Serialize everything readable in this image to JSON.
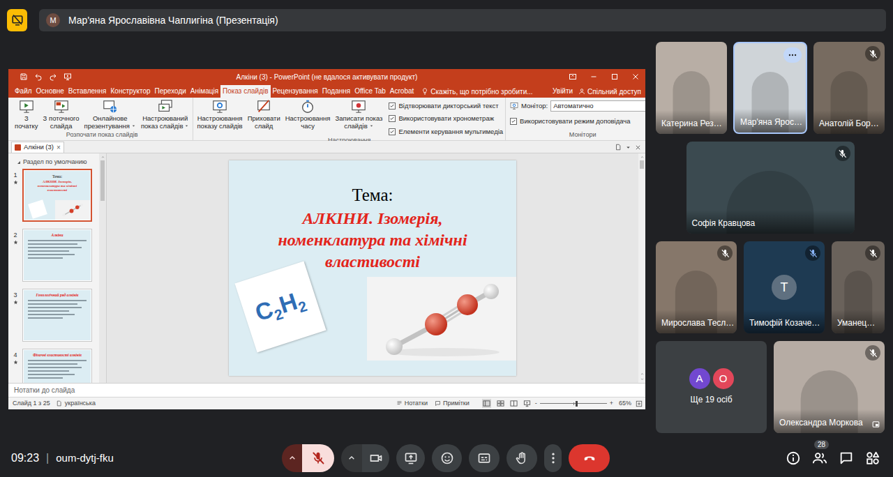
{
  "header": {
    "presenter_initial": "М",
    "presenter_title": "Мар'яна Ярославівна Чаплигіна (Презентація)"
  },
  "powerpoint": {
    "title": "Алкіни (3) - PowerPoint (не вдалося активувати продукт)",
    "tabs": [
      {
        "label": "Файл",
        "selected": false
      },
      {
        "label": "Основне",
        "selected": false
      },
      {
        "label": "Вставлення",
        "selected": false
      },
      {
        "label": "Конструктор",
        "selected": false
      },
      {
        "label": "Переходи",
        "selected": false
      },
      {
        "label": "Анімація",
        "selected": false
      },
      {
        "label": "Показ слайдів",
        "selected": true
      },
      {
        "label": "Рецензування",
        "selected": false
      },
      {
        "label": "Подання",
        "selected": false
      },
      {
        "label": "Office Tab",
        "selected": false
      },
      {
        "label": "Acrobat",
        "selected": false
      }
    ],
    "tell_me": "Скажіть, що потрібно зробити...",
    "sign_in": "Увійти",
    "share": "Спільний доступ",
    "groups": [
      {
        "label": "Розпочати показ слайдів",
        "buttons": [
          {
            "lines": [
              "З",
              "початку"
            ],
            "dropdown": false
          },
          {
            "lines": [
              "З поточного",
              "слайда"
            ],
            "dropdown": false
          },
          {
            "lines": [
              "Онлайнове",
              "презентування"
            ],
            "dropdown": true
          },
          {
            "lines": [
              "Настроюваний",
              "показ слайдів"
            ],
            "dropdown": true
          }
        ],
        "checkboxes": []
      },
      {
        "label": "Настроювання",
        "buttons": [
          {
            "lines": [
              "Настроювання",
              "показу слайдів"
            ],
            "dropdown": false
          },
          {
            "lines": [
              "Приховати",
              "слайд"
            ],
            "dropdown": false
          },
          {
            "lines": [
              "Настроювання",
              "часу"
            ],
            "dropdown": false
          },
          {
            "lines": [
              "Записати показ",
              "слайдів"
            ],
            "dropdown": true
          }
        ],
        "checkboxes": [
          {
            "label": "Відтворювати дикторський текст",
            "checked": true
          },
          {
            "label": "Використовувати хронометраж",
            "checked": true
          },
          {
            "label": "Елементи керування мультимедіа",
            "checked": true
          }
        ]
      }
    ],
    "monitors": {
      "label": "Монітори",
      "monitor_label": "Монітор:",
      "monitor_value": "Автоматично",
      "presenter_view": {
        "label": "Використовувати режим доповідача",
        "checked": true
      }
    },
    "doc_tab": {
      "label": "Алкіни (3)",
      "close": "×"
    },
    "slides_pane": {
      "section": "Раздел по умолчанию",
      "slides": [
        {
          "number": "1",
          "selected": true,
          "animated": true,
          "kind": "title",
          "heading": "Тема:",
          "title": "АЛКІНИ. Ізомерія, номенклатура та хімічні властивості"
        },
        {
          "number": "2",
          "selected": false,
          "animated": true,
          "kind": "content",
          "heading": "",
          "title": "Алкіни"
        },
        {
          "number": "3",
          "selected": false,
          "animated": true,
          "kind": "content",
          "heading": "",
          "title": "Гомологічний ряд алкінів"
        },
        {
          "number": "4",
          "selected": false,
          "animated": true,
          "kind": "content",
          "heading": "",
          "title": "Фізичні властивості алкінів"
        }
      ]
    },
    "slide": {
      "heading": "Тема:",
      "title": "АЛКІНИ. Ізомерія, номенклатура та хімічні властивості",
      "formula": [
        {
          "text": "C",
          "sub": false
        },
        {
          "text": "2",
          "sub": true
        },
        {
          "text": "H",
          "sub": false
        },
        {
          "text": "2",
          "sub": true
        }
      ]
    },
    "notes_placeholder": "Нотатки до слайда",
    "status_bar": {
      "slide": "Слайд 1 з 25",
      "language": "українська",
      "notes": "Нотатки",
      "comments": "Примітки",
      "zoom_minus": "-",
      "zoom_plus": "+",
      "zoom_level": 0.53,
      "zoom": "65%"
    }
  },
  "participants": [
    {
      "name": "Катерина Рез…",
      "kind": "video",
      "initial": "",
      "muted": false,
      "highlighted": false,
      "avatars": []
    },
    {
      "name": "Мар'яна Ярос…",
      "kind": "video",
      "initial": "",
      "muted": false,
      "highlighted": true,
      "avatars": []
    },
    {
      "name": "Анатолій Бор…",
      "kind": "video",
      "initial": "",
      "muted": true,
      "highlighted": false,
      "avatars": []
    },
    {
      "name": "Софія Кравцова",
      "kind": "video",
      "initial": "",
      "muted": true,
      "highlighted": false,
      "avatars": []
    },
    {
      "name": "Мирослава Тесл…",
      "kind": "video",
      "initial": "",
      "muted": true,
      "highlighted": false,
      "avatars": []
    },
    {
      "name": "Тимофій Козаче…",
      "kind": "avatar",
      "initial": "Т",
      "muted": true,
      "highlighted": false,
      "avatars": []
    },
    {
      "name": "Уманец…",
      "kind": "video",
      "initial": "",
      "muted": true,
      "highlighted": false,
      "avatars": []
    },
    {
      "name": "Ще 19 осіб",
      "kind": "more",
      "initial": "",
      "muted": false,
      "highlighted": false,
      "avatars": [
        {
          "initial": "А",
          "color": "#7248d0"
        },
        {
          "initial": "О",
          "color": "#e2475a"
        }
      ]
    },
    {
      "name": "Олександра Моркова",
      "kind": "video",
      "initial": "",
      "muted": true,
      "highlighted": false,
      "avatars": []
    }
  ],
  "bottom_bar": {
    "time": "09:23",
    "separator": "|",
    "meeting_code": "oum-dytj-fku",
    "mic_muted": true,
    "camera_on": true,
    "people_count": "28"
  }
}
